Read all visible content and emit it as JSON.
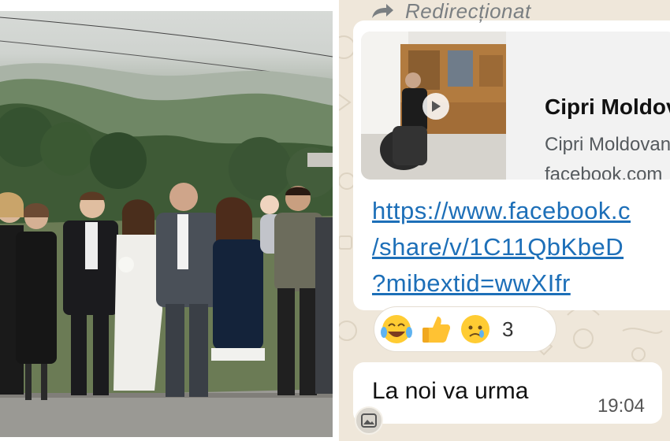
{
  "chat": {
    "forwarded_label": "Redirecționat",
    "link_preview": {
      "title": "Cipri Moldova",
      "subtitle": "Cipri Moldovan",
      "domain": "facebook.com"
    },
    "url_lines": [
      "https://www.facebook.c",
      "/share/v/1C11QbKbeD",
      "?mibextid=wwXIfr"
    ],
    "reactions": {
      "emojis": [
        "laughing-tears",
        "thumbs-up",
        "crying-face"
      ],
      "count": "3"
    },
    "message": {
      "text": "La noi va urma",
      "time": "19:04"
    },
    "colors": {
      "link": "#1d6fb8",
      "chat_bg": "#efe7da",
      "bubble": "#ffffff"
    }
  }
}
